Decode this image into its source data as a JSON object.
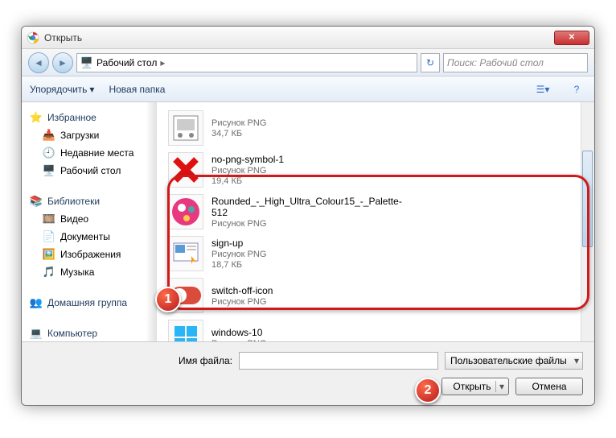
{
  "window": {
    "title": "Открыть"
  },
  "nav": {
    "location": "Рабочий стол",
    "search_placeholder": "Поиск: Рабочий стол"
  },
  "toolbar": {
    "organize": "Упорядочить",
    "newfolder": "Новая папка"
  },
  "sidebar": {
    "favorites": {
      "label": "Избранное",
      "items": [
        "Загрузки",
        "Недавние места",
        "Рабочий стол"
      ]
    },
    "libraries": {
      "label": "Библиотеки",
      "items": [
        "Видео",
        "Документы",
        "Изображения",
        "Музыка"
      ]
    },
    "homegroup": {
      "label": "Домашняя группа"
    },
    "computer": {
      "label": "Компьютер"
    }
  },
  "files": [
    {
      "name": "",
      "type": "Рисунок PNG",
      "size": "34,7 КБ"
    },
    {
      "name": "no-png-symbol-1",
      "type": "Рисунок PNG",
      "size": "19,4 КБ"
    },
    {
      "name": "Rounded_-_High_Ultra_Colour15_-_Palette-512",
      "type": "Рисунок PNG",
      "size": ""
    },
    {
      "name": "sign-up",
      "type": "Рисунок PNG",
      "size": "18,7 КБ"
    },
    {
      "name": "switch-off-icon",
      "type": "Рисунок PNG",
      "size": ""
    },
    {
      "name": "windows-10",
      "type": "Рисунок PNG",
      "size": ""
    }
  ],
  "bottom": {
    "filename_label": "Имя файла:",
    "filename_value": "",
    "filter": "Пользовательские файлы",
    "open": "Открыть",
    "cancel": "Отмена"
  },
  "annotations": {
    "b1": "1",
    "b2": "2"
  }
}
